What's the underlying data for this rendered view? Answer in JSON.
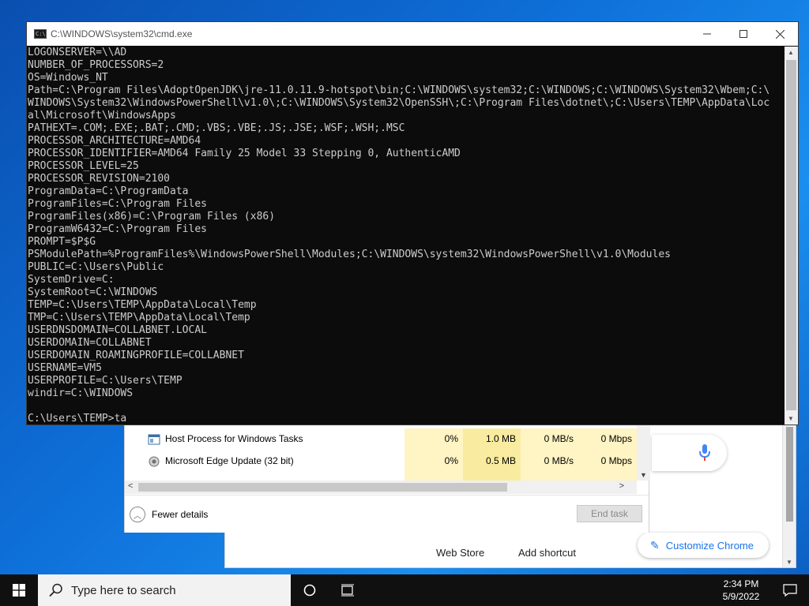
{
  "cmd": {
    "title": "C:\\WINDOWS\\system32\\cmd.exe",
    "lines": [
      "LOGONSERVER=\\\\AD",
      "NUMBER_OF_PROCESSORS=2",
      "OS=Windows_NT",
      "Path=C:\\Program Files\\AdoptOpenJDK\\jre-11.0.11.9-hotspot\\bin;C:\\WINDOWS\\system32;C:\\WINDOWS;C:\\WINDOWS\\System32\\Wbem;C:\\",
      "WINDOWS\\System32\\WindowsPowerShell\\v1.0\\;C:\\WINDOWS\\System32\\OpenSSH\\;C:\\Program Files\\dotnet\\;C:\\Users\\TEMP\\AppData\\Loc",
      "al\\Microsoft\\WindowsApps",
      "PATHEXT=.COM;.EXE;.BAT;.CMD;.VBS;.VBE;.JS;.JSE;.WSF;.WSH;.MSC",
      "PROCESSOR_ARCHITECTURE=AMD64",
      "PROCESSOR_IDENTIFIER=AMD64 Family 25 Model 33 Stepping 0, AuthenticAMD",
      "PROCESSOR_LEVEL=25",
      "PROCESSOR_REVISION=2100",
      "ProgramData=C:\\ProgramData",
      "ProgramFiles=C:\\Program Files",
      "ProgramFiles(x86)=C:\\Program Files (x86)",
      "ProgramW6432=C:\\Program Files",
      "PROMPT=$P$G",
      "PSModulePath=%ProgramFiles%\\WindowsPowerShell\\Modules;C:\\WINDOWS\\system32\\WindowsPowerShell\\v1.0\\Modules",
      "PUBLIC=C:\\Users\\Public",
      "SystemDrive=C:",
      "SystemRoot=C:\\WINDOWS",
      "TEMP=C:\\Users\\TEMP\\AppData\\Local\\Temp",
      "TMP=C:\\Users\\TEMP\\AppData\\Local\\Temp",
      "USERDNSDOMAIN=COLLABNET.LOCAL",
      "USERDOMAIN=COLLABNET",
      "USERDOMAIN_ROAMINGPROFILE=COLLABNET",
      "USERNAME=VM5",
      "USERPROFILE=C:\\Users\\TEMP",
      "windir=C:\\WINDOWS",
      "",
      "C:\\Users\\TEMP>ta"
    ]
  },
  "taskmgr": {
    "rows": [
      {
        "name": "Host Process for Windows Tasks",
        "cpu": "0%",
        "memory": "1.0 MB",
        "disk": "0 MB/s",
        "network": "0 Mbps"
      },
      {
        "name": "Microsoft Edge Update (32 bit)",
        "cpu": "0%",
        "memory": "0.5 MB",
        "disk": "0 MB/s",
        "network": "0 Mbps"
      }
    ],
    "fewer_details": "Fewer details",
    "end_task": "End task"
  },
  "chrome": {
    "web_store": "Web Store",
    "add_shortcut": "Add shortcut",
    "customize": "Customize Chrome"
  },
  "taskbar": {
    "search_placeholder": "Type here to search",
    "time": "2:34 PM",
    "date": "5/9/2022"
  },
  "colors": {
    "console_bg": "#0c0c0c",
    "console_fg": "#cccccc",
    "taskbar_bg": "#101010",
    "chrome_accent": "#1a73e8",
    "tm_highlight": "#fff4c4"
  }
}
